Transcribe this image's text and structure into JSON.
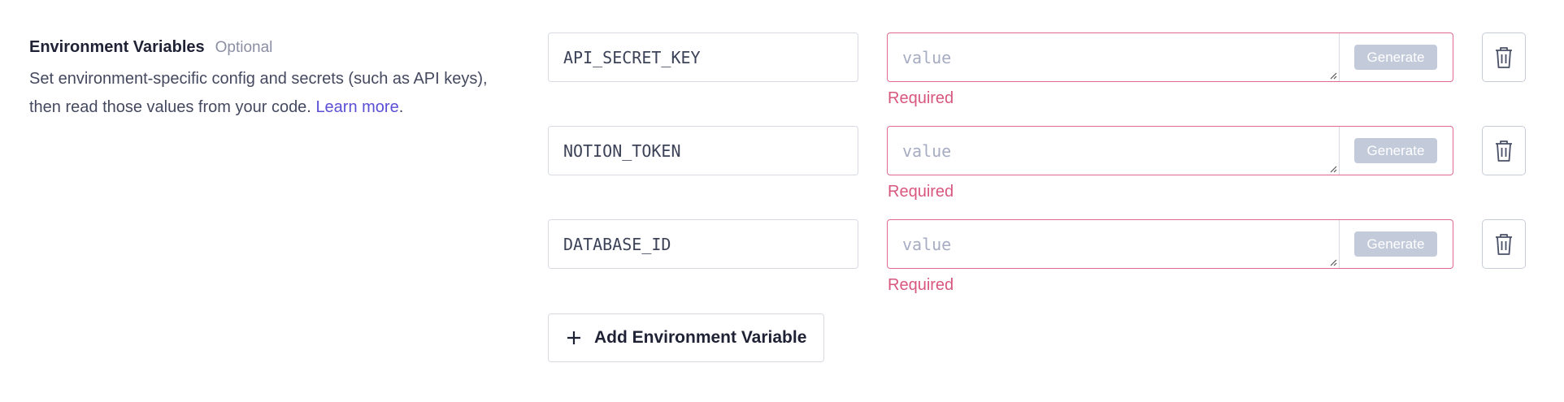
{
  "section": {
    "title": "Environment Variables",
    "optional_label": "Optional",
    "description": "Set environment-specific config and secrets (such as API keys), then read those values from your code.",
    "learn_more": "Learn more"
  },
  "env_vars": [
    {
      "key": "API_SECRET_KEY",
      "value": "",
      "value_placeholder": "value",
      "generate_label": "Generate",
      "error": "Required"
    },
    {
      "key": "NOTION_TOKEN",
      "value": "",
      "value_placeholder": "value",
      "generate_label": "Generate",
      "error": "Required"
    },
    {
      "key": "DATABASE_ID",
      "value": "",
      "value_placeholder": "value",
      "generate_label": "Generate",
      "error": "Required"
    }
  ],
  "add_button": {
    "label": "Add Environment Variable",
    "icon": "plus-icon"
  },
  "icons": {
    "delete": "trash-icon",
    "resize": "resize-handle-icon"
  },
  "colors": {
    "error": "#d9577f",
    "error_border": "#e06a8e",
    "link": "#5b4fd6",
    "generate_disabled_bg": "#c3cada",
    "border": "#d8dbe4"
  }
}
